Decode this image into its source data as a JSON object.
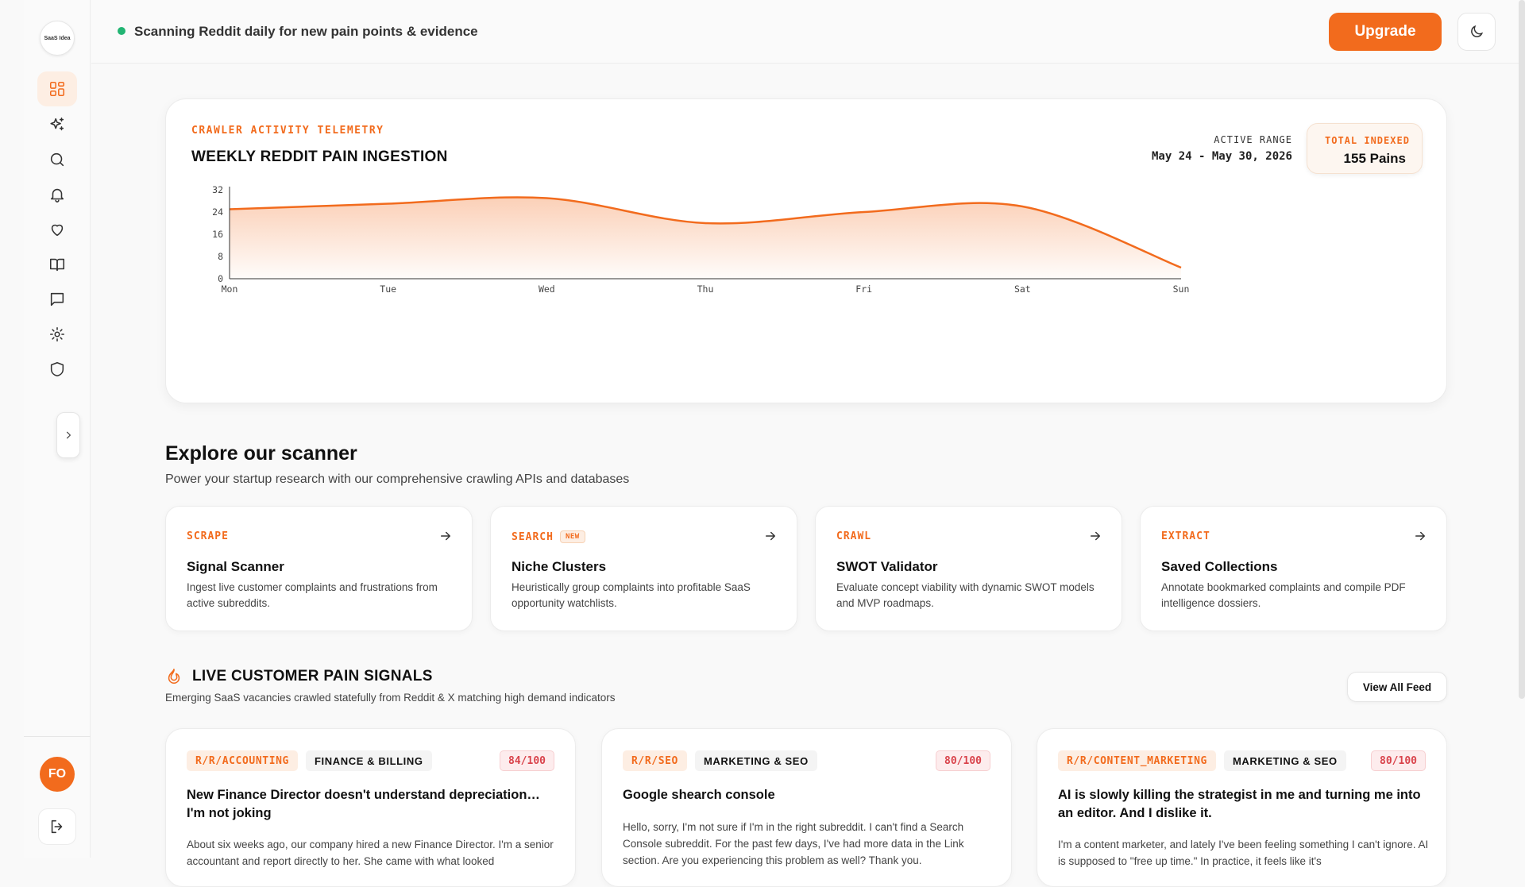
{
  "app": {
    "logo_text": "SaaS Idea"
  },
  "topbar": {
    "status": "Scanning Reddit daily for new pain points & evidence",
    "upgrade_label": "Upgrade"
  },
  "sidebar": {
    "items": [
      {
        "icon": "dashboard-icon",
        "active": true
      },
      {
        "icon": "sparkles-icon"
      },
      {
        "icon": "search-icon"
      },
      {
        "icon": "bell-icon"
      },
      {
        "icon": "heart-icon"
      },
      {
        "icon": "book-icon"
      },
      {
        "icon": "message-icon"
      },
      {
        "icon": "gear-icon"
      },
      {
        "icon": "shield-icon"
      }
    ],
    "avatar_initials": "FO"
  },
  "telemetry": {
    "kicker": "CRAWLER ACTIVITY TELEMETRY",
    "title": "WEEKLY REDDIT PAIN INGESTION",
    "range_label": "ACTIVE RANGE",
    "range_value": "May 24 - May 30, 2026",
    "total_label": "TOTAL INDEXED",
    "total_value": "155 Pains"
  },
  "chart_data": {
    "type": "area",
    "x": [
      "Mon",
      "Tue",
      "Wed",
      "Thu",
      "Fri",
      "Sat",
      "Sun"
    ],
    "values": [
      25,
      27,
      29,
      20,
      24,
      26,
      4
    ],
    "yticks": [
      0,
      8,
      16,
      24,
      32
    ],
    "ylim": [
      0,
      32
    ],
    "grid": false,
    "color": "#f26b1d"
  },
  "explore": {
    "title": "Explore our scanner",
    "subtitle": "Power your startup research with our comprehensive crawling APIs and databases",
    "cards": [
      {
        "tag": "SCRAPE",
        "badge": "",
        "name": "Signal Scanner",
        "desc": "Ingest live customer complaints and frustrations from active subreddits."
      },
      {
        "tag": "SEARCH",
        "badge": "NEW",
        "name": "Niche Clusters",
        "desc": "Heuristically group complaints into profitable SaaS opportunity watchlists."
      },
      {
        "tag": "CRAWL",
        "badge": "",
        "name": "SWOT Validator",
        "desc": "Evaluate concept viability with dynamic SWOT models and MVP roadmaps."
      },
      {
        "tag": "EXTRACT",
        "badge": "",
        "name": "Saved Collections",
        "desc": "Annotate bookmarked complaints and compile PDF intelligence dossiers."
      }
    ]
  },
  "signals": {
    "title": "LIVE CUSTOMER PAIN SIGNALS",
    "subtitle": "Emerging SaaS vacancies crawled statefully from Reddit & X matching high demand indicators",
    "view_all": "View All Feed",
    "cards": [
      {
        "subreddit": "R/R/ACCOUNTING",
        "category": "FINANCE & BILLING",
        "score": "84/100",
        "title": "New Finance Director doesn't understand depreciation… I'm not joking",
        "body": "About six weeks ago, our company hired a new Finance Director. I'm a senior accountant and report directly to her. She came with what looked"
      },
      {
        "subreddit": "R/R/SEO",
        "category": "MARKETING & SEO",
        "score": "80/100",
        "title": "Google shearch console",
        "body": "Hello, sorry, I'm not sure if I'm in the right subreddit. I can't find a Search Console subreddit. For the past few days, I've had more data in the Link section. Are you experiencing this problem as well? Thank you."
      },
      {
        "subreddit": "R/R/CONTENT_MARKETING",
        "category": "MARKETING & SEO",
        "score": "80/100",
        "title": "AI is slowly killing the strategist in me and turning me into an editor. And I dislike it.",
        "body": "I'm a content marketer, and lately I've been feeling something I can't ignore. AI is supposed to \"free up time.\" In practice, it feels like it's"
      }
    ]
  }
}
